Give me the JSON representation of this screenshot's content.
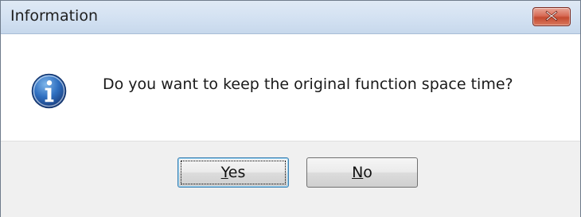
{
  "window": {
    "title": "Information",
    "close_icon": "close-icon"
  },
  "message": {
    "text": "Do you want to keep the original function space time?",
    "icon": "info-icon"
  },
  "buttons": {
    "yes": {
      "mnemonic": "Y",
      "rest": "es"
    },
    "no": {
      "mnemonic": "N",
      "rest": "o"
    }
  }
}
